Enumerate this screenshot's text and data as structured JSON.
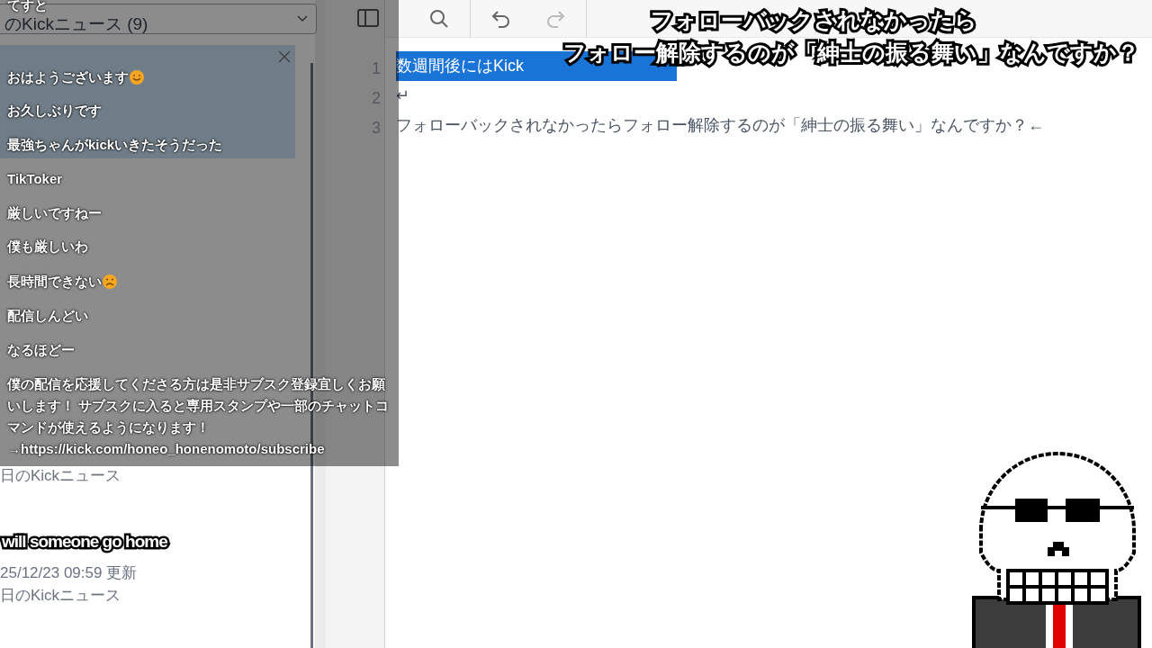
{
  "file_panel": {
    "dropdown": "のKickニュース (9)",
    "items": [
      {
        "text": "日のKickニュース"
      },
      {
        "text": "25/12/23  09:59 更新"
      },
      {
        "text": "日のKickニュース"
      }
    ]
  },
  "editor": {
    "lines": [
      {
        "number": "1",
        "text": "数週間後にはKick",
        "selected": true
      },
      {
        "number": "2",
        "text": "↵",
        "selected": false
      },
      {
        "number": "3",
        "text": "フォローバックされなかったらフォロー解除するのが「紳士の振る舞い」なんですか？←",
        "selected": false
      }
    ]
  },
  "chat_overlay": {
    "messages": [
      {
        "text": "てすと",
        "kind": "plain"
      },
      {
        "text": "おはようございます",
        "kind": "smiley"
      },
      {
        "text": "お久しぶりです",
        "kind": "plain"
      },
      {
        "text": "最強ちゃんがkickいきたそうだった",
        "kind": "plain"
      },
      {
        "text": "TikToker",
        "kind": "plain"
      },
      {
        "text": "厳しいですねー",
        "kind": "plain"
      },
      {
        "text": "僕も厳しいわ",
        "kind": "plain"
      },
      {
        "text": "長時間できない",
        "kind": "frowny"
      },
      {
        "text": "配信しんどい",
        "kind": "plain"
      },
      {
        "text": "なるほどー",
        "kind": "plain"
      },
      {
        "text": "僕の配信を応援してくださる方は是非サブスク登録宜しくお願いします！ サブスクに入ると専用スタンプや一部のチャットコマンドが使えるようになります！\n→https://kick.com/honeo_honenomoto/subscribe",
        "kind": "plain"
      }
    ]
  },
  "caption": {
    "lines": [
      "フォローバックされなかったら",
      "フォロー解除するのが「紳士の振る舞い」なんですか？"
    ]
  },
  "subtitle": "will someone go home"
}
